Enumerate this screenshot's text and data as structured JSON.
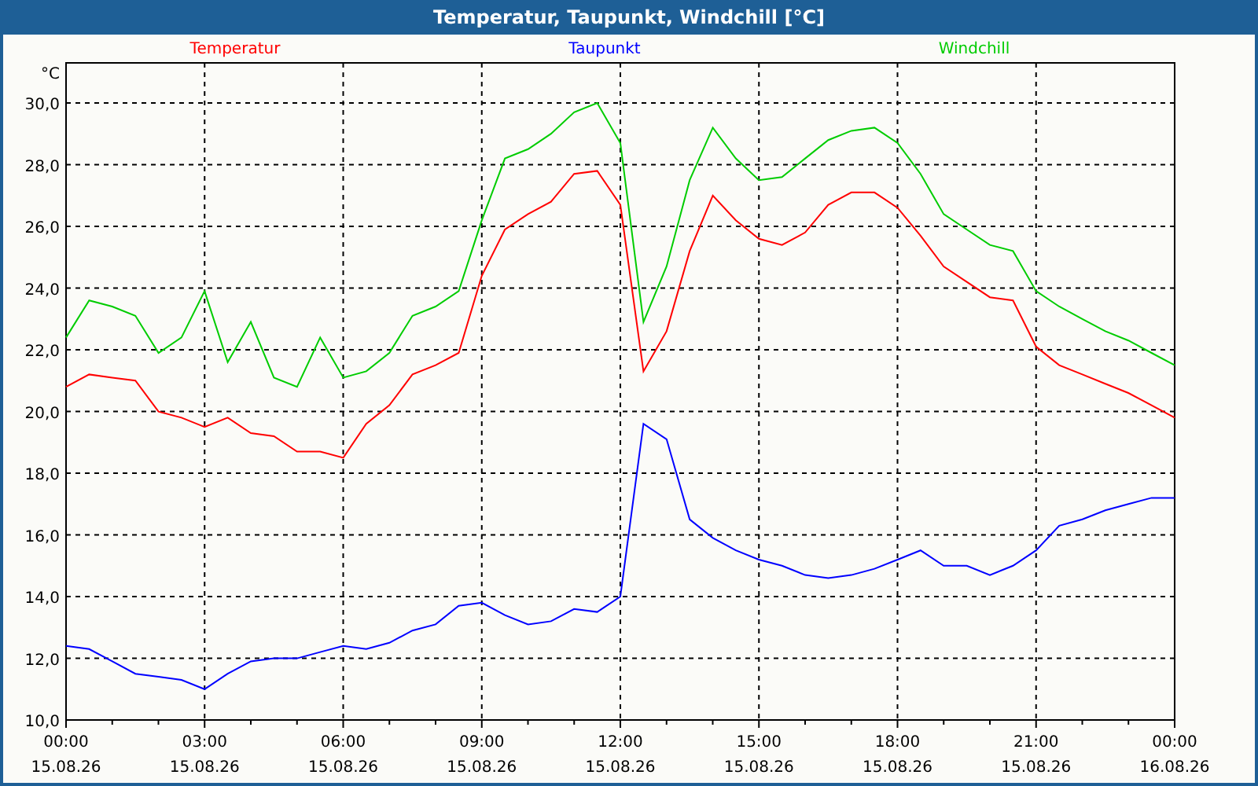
{
  "window": {
    "title": "Temperatur, Taupunkt, Windchill [°C]"
  },
  "chart": {
    "chart_data": {
      "type": "line",
      "grid": true,
      "ylabel": "°C",
      "ylim": [
        10,
        31.3
      ],
      "categories": [
        "00:00 15.08.26",
        null,
        null,
        null,
        null,
        null,
        "03:00 15.08.26",
        null,
        null,
        null,
        null,
        null,
        "06:00 15.08.26",
        null,
        null,
        null,
        null,
        null,
        "09:00 15.08.26",
        null,
        null,
        null,
        null,
        null,
        "12:00 15.08.26",
        null,
        null,
        null,
        null,
        null,
        "15:00 15.08.26",
        null,
        null,
        null,
        null,
        null,
        "18:00 15.08.26",
        null,
        null,
        null,
        null,
        null,
        "21:00 15.08.26",
        null,
        null,
        null,
        null,
        null,
        "00:00 16.08.26"
      ],
      "yticks": [
        {
          "value": 10,
          "label": "10,0"
        },
        {
          "value": 12,
          "label": "12,0"
        },
        {
          "value": 14,
          "label": "14,0"
        },
        {
          "value": 16,
          "label": "16,0"
        },
        {
          "value": 18,
          "label": "18,0"
        },
        {
          "value": 20,
          "label": "20,0"
        },
        {
          "value": 22,
          "label": "22,0"
        },
        {
          "value": 24,
          "label": "24,0"
        },
        {
          "value": 26,
          "label": "26,0"
        },
        {
          "value": 28,
          "label": "28,0"
        },
        {
          "value": 30,
          "label": "30,0"
        }
      ],
      "series": [
        {
          "name": "Temperatur",
          "color": "#ff0000",
          "values": [
            20.8,
            21.2,
            21.1,
            21.0,
            20.0,
            19.8,
            19.5,
            19.8,
            19.3,
            19.2,
            18.7,
            18.7,
            18.5,
            19.6,
            20.2,
            21.2,
            21.5,
            21.9,
            24.4,
            25.9,
            26.4,
            26.8,
            27.7,
            27.8,
            26.7,
            21.3,
            22.6,
            25.2,
            27.0,
            26.2,
            25.6,
            25.4,
            25.8,
            26.7,
            27.1,
            27.1,
            26.6,
            25.7,
            24.7,
            24.2,
            23.7,
            23.6,
            22.1,
            21.5,
            21.2,
            20.9,
            20.6,
            20.2,
            19.8
          ]
        },
        {
          "name": "Taupunkt",
          "color": "#0000ff",
          "values": [
            12.4,
            12.3,
            11.9,
            11.5,
            11.4,
            11.3,
            11.0,
            11.5,
            11.9,
            12.0,
            12.0,
            12.2,
            12.4,
            12.3,
            12.5,
            12.9,
            13.1,
            13.7,
            13.8,
            13.4,
            13.1,
            13.2,
            13.6,
            13.5,
            14.0,
            19.6,
            19.1,
            16.5,
            15.9,
            15.5,
            15.2,
            15.0,
            14.7,
            14.6,
            14.7,
            14.9,
            15.2,
            15.5,
            15.0,
            15.0,
            14.7,
            15.0,
            15.5,
            16.3,
            16.5,
            16.8,
            17.0,
            17.2,
            17.2
          ]
        },
        {
          "name": "Windchill",
          "color": "#00cc00",
          "values": [
            22.4,
            23.6,
            23.4,
            23.1,
            21.9,
            22.4,
            23.9,
            21.6,
            22.9,
            21.1,
            20.8,
            22.4,
            21.1,
            21.3,
            21.9,
            23.1,
            23.4,
            23.9,
            26.2,
            28.2,
            28.5,
            29.0,
            29.7,
            30.0,
            28.7,
            22.9,
            24.7,
            27.5,
            29.2,
            28.2,
            27.5,
            27.6,
            28.2,
            28.8,
            29.1,
            29.2,
            28.7,
            27.7,
            26.4,
            25.9,
            25.4,
            25.2,
            23.9,
            23.4,
            23.0,
            22.6,
            22.3,
            21.9,
            21.5
          ]
        }
      ]
    }
  }
}
